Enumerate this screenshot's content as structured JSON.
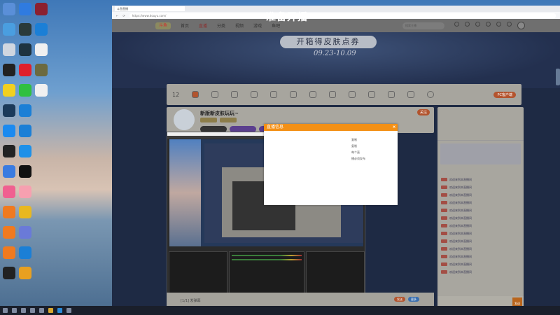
{
  "overlay_title": "准备开播",
  "browser": {
    "tab_title": "斗鱼直播",
    "url": "https://www.douyu.com/"
  },
  "site_nav": {
    "logo": "斗鱼",
    "items": [
      "首页",
      "直播",
      "分类",
      "视频",
      "游戏",
      "鱼吧"
    ],
    "search_placeholder": "搜索主播"
  },
  "banner": {
    "headline": "开箱得皮肤点券",
    "dates": "09.23-10.09"
  },
  "toolbar": {
    "count": "12",
    "pc_button": "PC客户端"
  },
  "stream": {
    "title": "新版新皮肤玩玩~",
    "follow": "关注"
  },
  "popup": {
    "title": "直播信息",
    "close": "×",
    "lines": [
      "复制",
      "复制",
      "",
      "每个直",
      "播必须发布"
    ]
  },
  "chat": {
    "send": "发送",
    "messages": [
      "欢迎来到本直播间",
      "欢迎来到本直播间",
      "欢迎来到本直播间",
      "欢迎来到本直播间",
      "欢迎来到本直播间",
      "欢迎来到本直播间",
      "欢迎来到本直播间",
      "欢迎来到本直播间",
      "欢迎来到本直播间",
      "欢迎来到本直播间",
      "欢迎来到本直播间",
      "欢迎来到本直播间",
      "欢迎来到本直播间"
    ]
  },
  "giftbar": {
    "danmu": "[1/1] 发弹幕",
    "btn1": "发送",
    "btn2": "更多"
  },
  "desktop_icon_colors": [
    "#5a8fd8",
    "#2f7be0",
    "#8b2030",
    "#4a9ee0",
    "#2a3a3a",
    "#1b7fd6",
    "#cfd6e0",
    "#1e3340",
    "#f0f0f0",
    "#222",
    "#e0202c",
    "#6c6a40",
    "#f2d020",
    "#30c040",
    "#f0f0f0",
    "#1b3a5a",
    "#1b7fd6",
    "#00000000",
    "#1b8af0",
    "#1b7fd6",
    "#00000000",
    "#222",
    "#1e90e8",
    "#00000000",
    "#3a7be0",
    "#111",
    "#00000000",
    "#f06090",
    "#f6a0b0",
    "#00000000",
    "#f07a20",
    "#e8b820",
    "#00000000",
    "#f07a20",
    "#6a7ad8",
    "#00000000",
    "#f07a20",
    "#1b7fd6",
    "#00000000",
    "#222",
    "#e8a020",
    "#00000000"
  ]
}
